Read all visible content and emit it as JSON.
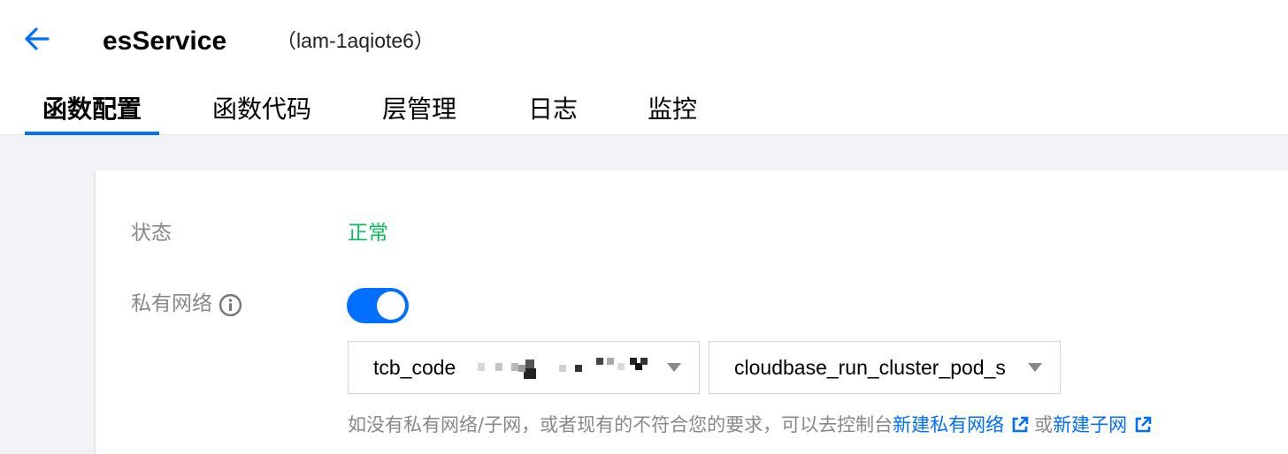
{
  "header": {
    "title": "esService",
    "function_id": "（lam-1aqiote6）"
  },
  "tabs": [
    {
      "label": "函数配置",
      "active": true
    },
    {
      "label": "函数代码",
      "active": false
    },
    {
      "label": "层管理",
      "active": false
    },
    {
      "label": "日志",
      "active": false
    },
    {
      "label": "监控",
      "active": false
    }
  ],
  "config": {
    "status_label": "状态",
    "status_value": "正常",
    "status_color": "#0abf5b",
    "vpc_label": "私有网络",
    "vpc_enabled": true,
    "vpc_select_value": "tcb_code",
    "subnet_select_value": "cloudbase_run_cluster_pod_s",
    "help_text": "如没有私有网络/子网，或者现有的不符合您的要求，可以去控制台",
    "create_vpc_link": "新建私有网络",
    "or_text": "或",
    "create_subnet_link": "新建子网"
  },
  "icons": {
    "back": "arrow-left-icon",
    "info": "info-circle-icon",
    "external": "external-link-icon",
    "caret": "caret-down-icon"
  },
  "colors": {
    "accent": "#006eff",
    "success": "#0abf5b",
    "muted_text": "#888888"
  }
}
